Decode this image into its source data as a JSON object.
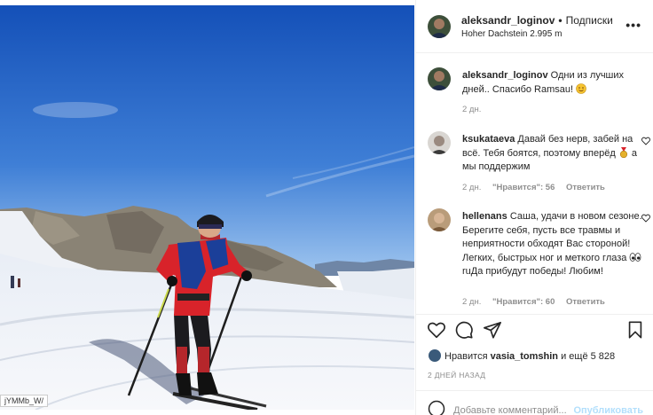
{
  "post": {
    "photo_tag": "jYMMb_W/",
    "author": "aleksandr_loginov",
    "follow_label": "Подписки",
    "location": "Hoher Dachstein 2.995 m",
    "more_icon": "more-horizontal-icon"
  },
  "caption": {
    "author": "aleksandr_loginov",
    "text": "Одни из лучших дней.. Спасибо Ramsau!",
    "time": "2 дн."
  },
  "comments": [
    {
      "author": "ksukataeva",
      "text_before": "Давай без нерв, забей на всё. Тебя боятся, поэтому вперёд",
      "text_after": "а мы поддержим",
      "time": "2 дн.",
      "likes": "\"Нравится\": 56",
      "reply": "Ответить"
    },
    {
      "author": "hellenans",
      "text_before": "Саша, удачи в новом сезоне. Берегите себя, пусть все травмы и неприятности обходят Вас стороной! Легких, быстрых ног и меткого глаза",
      "text_after": "ruДа прибудут победы! Любим!",
      "time": "2 дн.",
      "likes": "\"Нравится\": 60",
      "reply": "Ответить"
    }
  ],
  "actions": {
    "like_icon": "heart-icon",
    "comment_icon": "comment-icon",
    "share_icon": "send-icon",
    "save_icon": "bookmark-icon"
  },
  "likes": {
    "prefix": "Нравится",
    "user": "vasia_tomshin",
    "suffix": "и ещё 5 828"
  },
  "date": "2 ДНЕЙ НАЗАД",
  "add_comment": {
    "placeholder": "Добавьте комментарий...",
    "publish": "Опубликовать"
  },
  "colors": {
    "sky_top": "#1a5cc4",
    "sky_bottom": "#8bb6ea",
    "snow": "#f4f6fa",
    "jacket_red": "#d8232a",
    "jacket_blue": "#1b3f99",
    "link_blue": "#b2dffc"
  }
}
